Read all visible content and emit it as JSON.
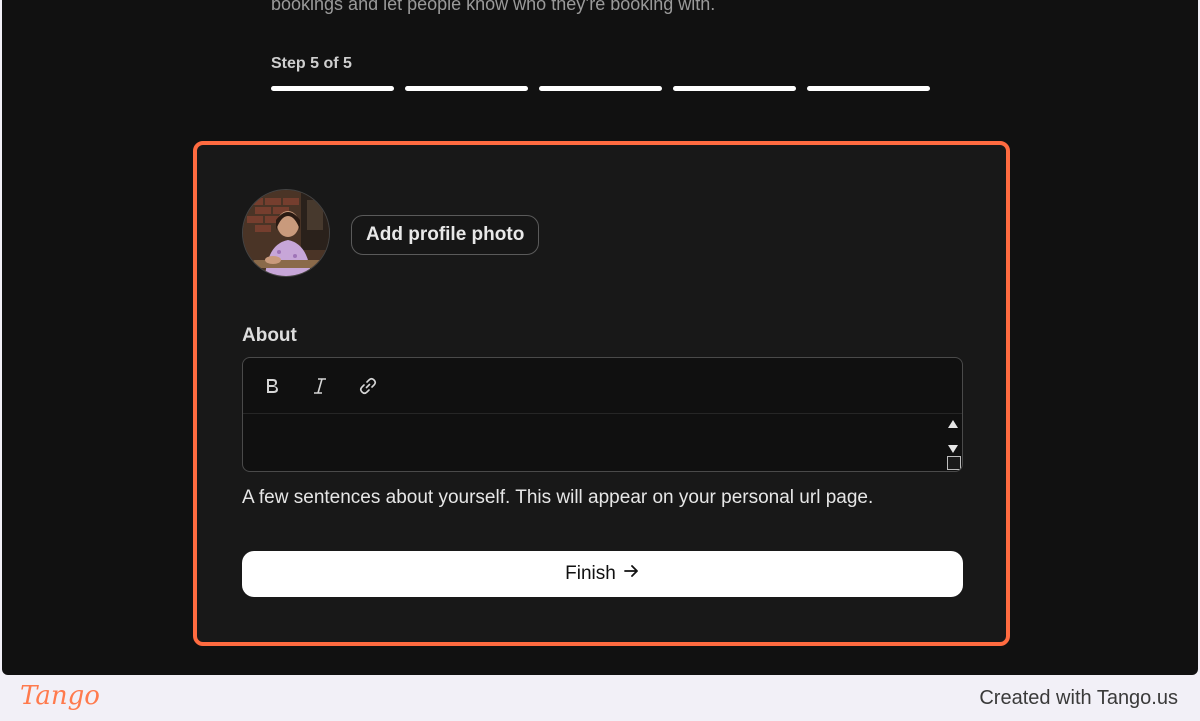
{
  "onboarding": {
    "intro_text": "bookings and let people know who they’re booking with.",
    "step_label": "Step 5 of 5",
    "steps_total": 5,
    "steps_completed": 5
  },
  "profile": {
    "add_photo_label": "Add profile photo"
  },
  "about": {
    "label": "About",
    "value": "",
    "helper_text": "A few sentences about yourself. This will appear on your personal url page.",
    "toolbar": [
      "bold-icon",
      "italic-icon",
      "link-icon"
    ]
  },
  "actions": {
    "finish_label": "Finish"
  },
  "footer": {
    "logo_text": "Tango",
    "created_with": "Created with Tango.us"
  },
  "colors": {
    "highlight": "#ff6b40",
    "background": "#111111",
    "card": "#181818"
  }
}
